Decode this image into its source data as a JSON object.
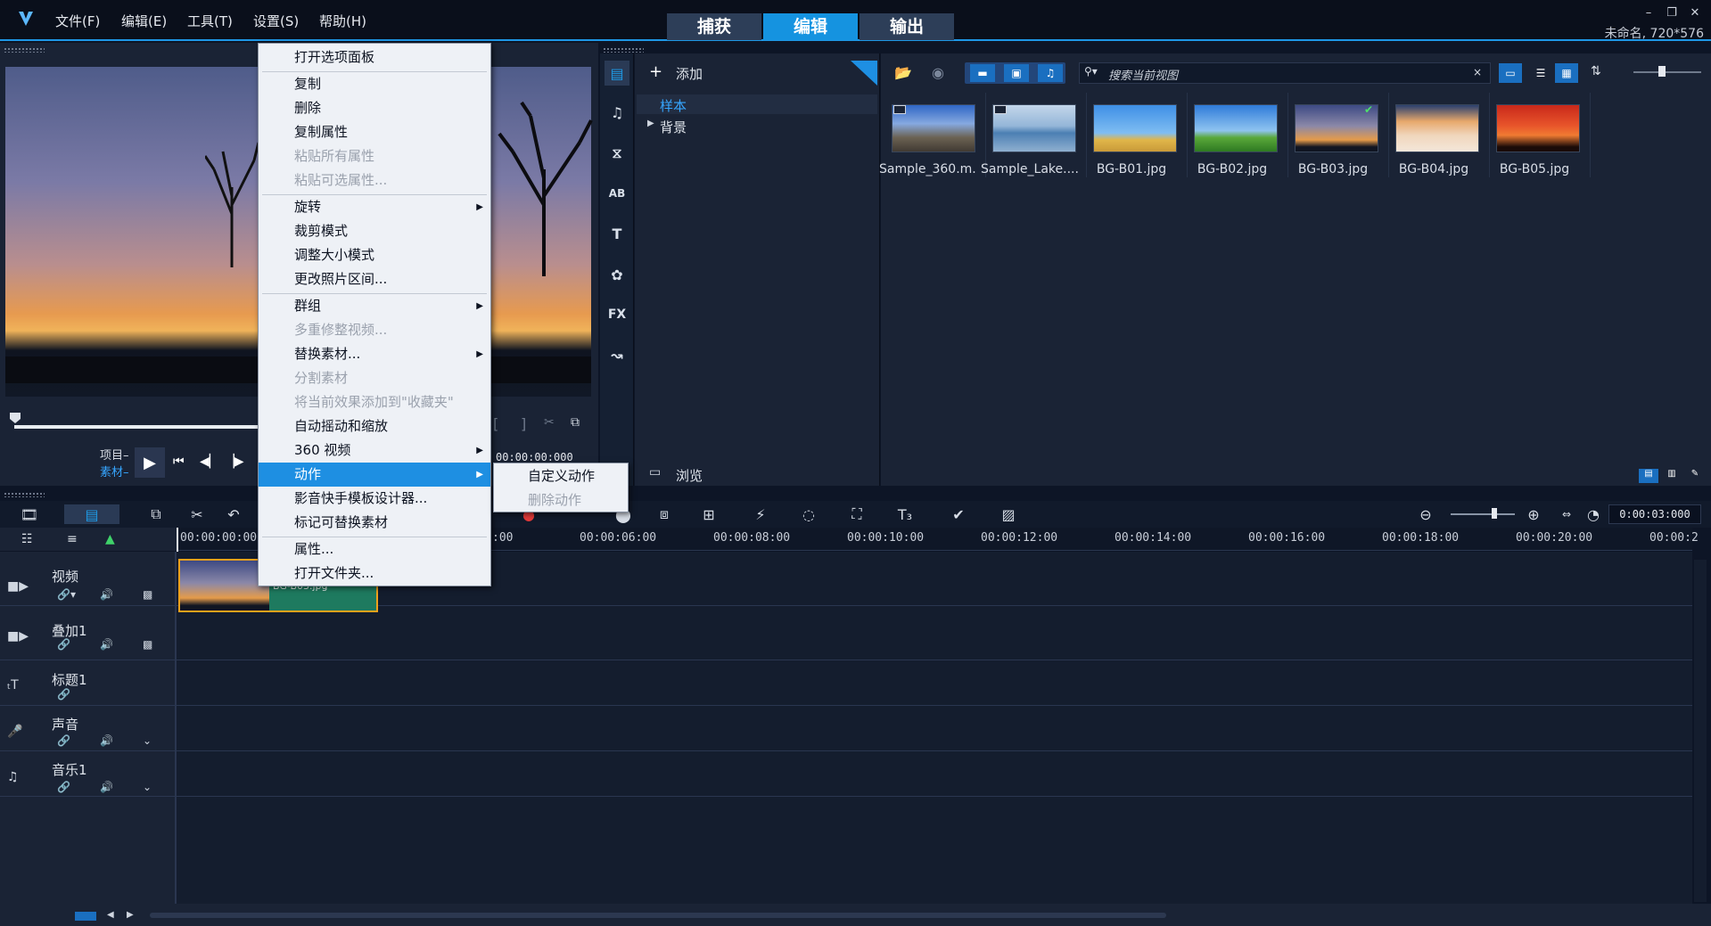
{
  "menubar": {
    "items": [
      "文件(F)",
      "编辑(E)",
      "工具(T)",
      "设置(S)",
      "帮助(H)"
    ]
  },
  "modes": {
    "capture": "捕获",
    "edit": "编辑",
    "share": "输出"
  },
  "project": {
    "info": "未命名, 720*576"
  },
  "player": {
    "project_label": "项目",
    "clip_label": "素材",
    "timecode": "00:00:00:000"
  },
  "library": {
    "add_label": "添加",
    "search_placeholder": "搜索当前视图",
    "folders": [
      "样本",
      "背景"
    ],
    "browse_label": "浏览",
    "thumbs": [
      {
        "label": "Sample_360.m..."
      },
      {
        "label": "Sample_Lake...."
      },
      {
        "label": "BG-B01.jpg"
      },
      {
        "label": "BG-B02.jpg"
      },
      {
        "label": "BG-B03.jpg"
      },
      {
        "label": "BG-B04.jpg"
      },
      {
        "label": "BG-B05.jpg"
      }
    ]
  },
  "timeline": {
    "timecode": "0:00:03:000",
    "ticks": [
      "00:00:00:00",
      ":00",
      "00:00:06:00",
      "00:00:08:00",
      "00:00:10:00",
      "00:00:12:00",
      "00:00:14:00",
      "00:00:16:00",
      "00:00:18:00",
      "00:00:20:00",
      "00:00:2"
    ],
    "tracks": [
      "视频",
      "叠加1",
      "标题1",
      "声音",
      "音乐1"
    ],
    "clip_label": "BG-B03.jpg"
  },
  "context_menu": {
    "items": [
      {
        "label": "打开选项面板",
        "disabled": false
      },
      {
        "label": "复制",
        "disabled": false
      },
      {
        "label": "删除",
        "disabled": false
      },
      {
        "label": "复制属性",
        "disabled": false
      },
      {
        "label": "粘贴所有属性",
        "disabled": true
      },
      {
        "label": "粘贴可选属性...",
        "disabled": true
      },
      {
        "label": "旋转",
        "disabled": false
      },
      {
        "label": "裁剪模式",
        "disabled": false
      },
      {
        "label": "调整大小模式",
        "disabled": false
      },
      {
        "label": "更改照片区间...",
        "disabled": false
      },
      {
        "label": "群组",
        "disabled": false
      },
      {
        "label": "多重修整视频...",
        "disabled": true
      },
      {
        "label": "替换素材...",
        "disabled": false
      },
      {
        "label": "分割素材",
        "disabled": true
      },
      {
        "label": "将当前效果添加到\"收藏夹\"",
        "disabled": true
      },
      {
        "label": "自动摇动和缩放",
        "disabled": false
      },
      {
        "label": "360 视频",
        "disabled": false
      },
      {
        "label": "动作",
        "disabled": false
      },
      {
        "label": "影音快手模板设计器...",
        "disabled": false
      },
      {
        "label": "标记可替换素材",
        "disabled": false
      },
      {
        "label": "属性...",
        "disabled": false
      },
      {
        "label": "打开文件夹...",
        "disabled": false
      }
    ],
    "submenu": [
      {
        "label": "自定义动作",
        "disabled": false
      },
      {
        "label": "删除动作",
        "disabled": true
      }
    ]
  },
  "colors": {
    "accent": "#1593e0",
    "background": "#1a2335"
  }
}
